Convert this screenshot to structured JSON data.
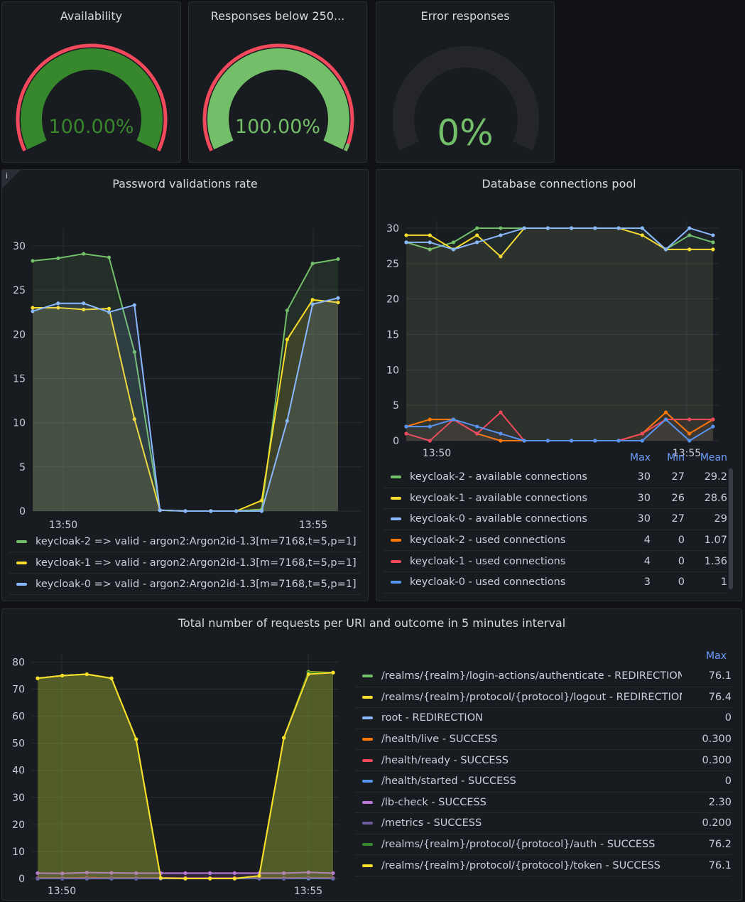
{
  "gauges": [
    {
      "title": "Availability",
      "value_text": "100.00%",
      "value": 100,
      "color": "#37872d"
    },
    {
      "title": "Responses below 250...",
      "value_text": "100.00%",
      "value": 100,
      "color": "#73bf69"
    },
    {
      "title": "Error responses",
      "value_text": "0%",
      "value": 0,
      "color": "#73bf69"
    }
  ],
  "password_panel": {
    "title": "Password validations rate",
    "info_icon": "i",
    "chart_data": {
      "type": "area",
      "x_ticks": [
        "13:50",
        "13:55"
      ],
      "y_ticks": [
        "0",
        "5",
        "10",
        "15",
        "20",
        "25",
        "30"
      ],
      "ylim": [
        0,
        32
      ],
      "series": [
        {
          "name": "keycloak-2 => valid - argon2:Argon2id-1.3[m=7168,t=5,p=1]",
          "color": "#73bf69",
          "values": [
            28.3,
            28.6,
            29.1,
            28.7,
            18,
            0.1,
            0,
            0,
            0,
            0.2,
            22.7,
            28,
            28.5
          ]
        },
        {
          "name": "keycloak-1 => valid - argon2:Argon2id-1.3[m=7168,t=5,p=1]",
          "color": "#fade2a",
          "values": [
            23,
            23,
            22.8,
            22.9,
            10.4,
            0.1,
            0,
            0,
            0,
            1.2,
            19.4,
            23.9,
            23.6
          ]
        },
        {
          "name": "keycloak-0 => valid - argon2:Argon2id-1.3[m=7168,t=5,p=1]",
          "color": "#8ab8ff",
          "values": [
            22.6,
            23.5,
            23.5,
            22.5,
            23.3,
            0.1,
            0,
            0,
            0,
            0,
            10.2,
            23.4,
            24.1
          ]
        }
      ]
    }
  },
  "db_panel": {
    "title": "Database connections pool",
    "headers": {
      "max": "Max",
      "min": "Min",
      "mean": "Mean"
    },
    "chart_data": {
      "type": "line",
      "x_ticks": [
        "13:50",
        "13:55"
      ],
      "y_ticks": [
        "0",
        "5",
        "10",
        "15",
        "20",
        "25",
        "30"
      ],
      "ylim": [
        0,
        31
      ],
      "series": [
        {
          "name": "keycloak-2 - available connections",
          "color": "#73bf69",
          "max": "30",
          "min": "27",
          "mean": "29.2",
          "values": [
            28,
            27,
            28,
            30,
            30,
            30,
            30,
            30,
            30,
            30,
            30,
            27,
            29,
            28
          ]
        },
        {
          "name": "keycloak-1 - available connections",
          "color": "#fade2a",
          "max": "30",
          "min": "26",
          "mean": "28.6",
          "values": [
            29,
            29,
            27,
            29,
            26,
            30,
            30,
            30,
            30,
            30,
            29,
            27,
            27,
            27
          ]
        },
        {
          "name": "keycloak-0 - available connections",
          "color": "#8ab8ff",
          "max": "30",
          "min": "27",
          "mean": "29",
          "values": [
            28,
            28,
            27,
            28,
            29,
            30,
            30,
            30,
            30,
            30,
            30,
            27,
            30,
            29
          ]
        },
        {
          "name": "keycloak-2 - used connections",
          "color": "#ff780a",
          "max": "4",
          "min": "0",
          "mean": "1.07",
          "values": [
            2,
            3,
            3,
            1,
            0,
            0,
            0,
            0,
            0,
            0,
            1,
            4,
            1,
            3
          ]
        },
        {
          "name": "keycloak-1 - used connections",
          "color": "#f2495c",
          "max": "4",
          "min": "0",
          "mean": "1.36",
          "values": [
            1,
            0,
            3,
            1,
            4,
            0,
            0,
            0,
            0,
            0,
            1,
            3,
            3,
            3
          ]
        },
        {
          "name": "keycloak-0 - used connections",
          "color": "#5794f2",
          "max": "3",
          "min": "0",
          "mean": "1",
          "values": [
            2,
            2,
            3,
            2,
            1,
            0,
            0,
            0,
            0,
            0,
            0,
            3,
            0,
            2
          ]
        }
      ]
    }
  },
  "requests_panel": {
    "title": "Total number of requests per URI and outcome in 5 minutes interval",
    "headers": {
      "max": "Max"
    },
    "chart_data": {
      "type": "area",
      "x_ticks": [
        "13:50",
        "13:55"
      ],
      "y_ticks": [
        "0",
        "10",
        "20",
        "30",
        "40",
        "50",
        "60",
        "70",
        "80"
      ],
      "ylim": [
        0,
        83
      ],
      "series": [
        {
          "name": "/realms/{realm}/login-actions/authenticate - REDIRECTION",
          "color": "#73bf69",
          "max": "76.1",
          "values": [
            74,
            75,
            75.5,
            74,
            51.5,
            0.2,
            0,
            0,
            0,
            1,
            52,
            76.2,
            76.1
          ]
        },
        {
          "name": "/realms/{realm}/protocol/{protocol}/logout - REDIRECTION",
          "color": "#fade2a",
          "max": "76.4",
          "values": [
            74,
            75,
            75.5,
            74,
            51.5,
            0.2,
            0,
            0,
            0,
            1,
            52,
            76.4,
            76.1
          ]
        },
        {
          "name": "root - REDIRECTION",
          "color": "#8ab8ff",
          "max": "0",
          "values": [
            0,
            0,
            0,
            0,
            0,
            0,
            0,
            0,
            0,
            0,
            0,
            0,
            0
          ]
        },
        {
          "name": "/health/live - SUCCESS",
          "color": "#ff780a",
          "max": "0.300",
          "values": [
            0.2,
            0.2,
            0.3,
            0.2,
            0.2,
            0.2,
            0.2,
            0.2,
            0.2,
            0.2,
            0.2,
            0.3,
            0.2
          ]
        },
        {
          "name": "/health/ready - SUCCESS",
          "color": "#f2495c",
          "max": "0.300",
          "values": [
            0.2,
            0.2,
            0.3,
            0.2,
            0.2,
            0.2,
            0.2,
            0.2,
            0.2,
            0.2,
            0.2,
            0.3,
            0.2
          ]
        },
        {
          "name": "/health/started - SUCCESS",
          "color": "#5794f2",
          "max": "0",
          "values": [
            0,
            0,
            0,
            0,
            0,
            0,
            0,
            0,
            0,
            0,
            0,
            0,
            0
          ]
        },
        {
          "name": "/lb-check - SUCCESS",
          "color": "#b877d9",
          "max": "2.30",
          "values": [
            2,
            1.9,
            2.2,
            2.1,
            2,
            2,
            2,
            2,
            2,
            2,
            2,
            2.3,
            2
          ]
        },
        {
          "name": "/metrics - SUCCESS",
          "color": "#705da0",
          "max": "0.200",
          "values": [
            0.1,
            0.1,
            0.1,
            0.1,
            0.1,
            0.1,
            0.1,
            0.1,
            0.1,
            0.1,
            0.1,
            0.2,
            0.1
          ]
        },
        {
          "name": "/realms/{realm}/protocol/{protocol}/auth - SUCCESS",
          "color": "#37872d",
          "max": "76.2",
          "values": [
            74,
            75,
            75.5,
            74,
            51.5,
            0.2,
            0,
            0,
            0,
            1,
            52,
            76.2,
            76.1
          ]
        },
        {
          "name": "/realms/{realm}/protocol/{protocol}/token - SUCCESS",
          "color": "#fade2a",
          "max": "76.1",
          "values": [
            74,
            75,
            75.5,
            74,
            51.5,
            0.2,
            0,
            0,
            0,
            1,
            52,
            75.5,
            76.1
          ]
        }
      ]
    }
  }
}
